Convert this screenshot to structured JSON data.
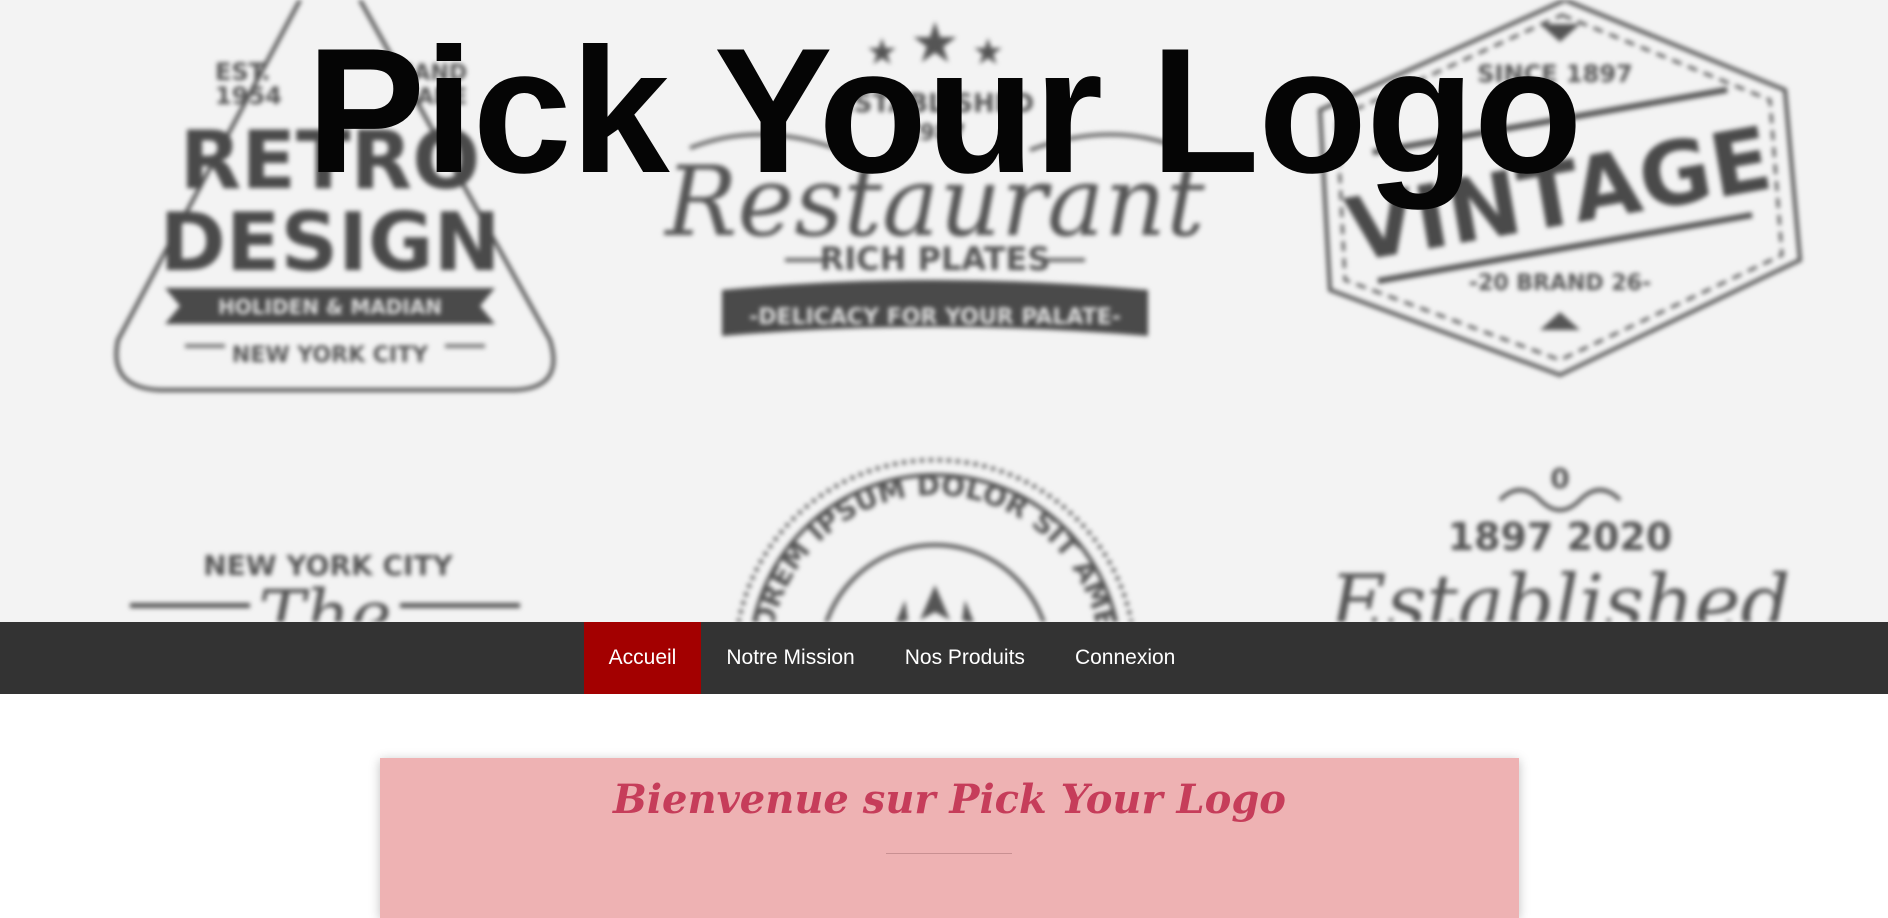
{
  "hero": {
    "title": "Pick Your Logo",
    "emblems": {
      "retro": {
        "est": "EST.",
        "year": "1954",
        "hand1": "HAND",
        "hand2": "MADE",
        "line1": "RETRO",
        "line2": "DESIGN",
        "banner": "HOLIDEN & MADIAN",
        "city": "NEW YORK CITY"
      },
      "restaurant": {
        "established": "ESTABLISHED",
        "year": "1987",
        "name": "Restaurant",
        "sub": "RICH PLATES",
        "banner": "-DELICACY FOR YOUR PALATE-"
      },
      "vintage": {
        "since": "SINCE 1897",
        "name": "VINTAGE",
        "brand": "-20 BRAND 26-"
      },
      "newyork": {
        "city": "NEW YORK CITY",
        "the": "The"
      },
      "lorem": {
        "text": "LOREM IPSUM DOLOR SIT AMET"
      },
      "established": {
        "zero": "0",
        "years": "1897   2020",
        "name": "Established"
      }
    }
  },
  "nav": {
    "items": [
      "Accueil",
      "Notre Mission",
      "Nos Produits",
      "Connexion"
    ],
    "active_index": 0
  },
  "welcome": {
    "title": "Bienvenue sur Pick Your Logo"
  },
  "colors": {
    "nav_bg": "#333333",
    "nav_active": "#a30000",
    "card_bg": "#eeb2b3",
    "card_title": "#c63d5a"
  }
}
